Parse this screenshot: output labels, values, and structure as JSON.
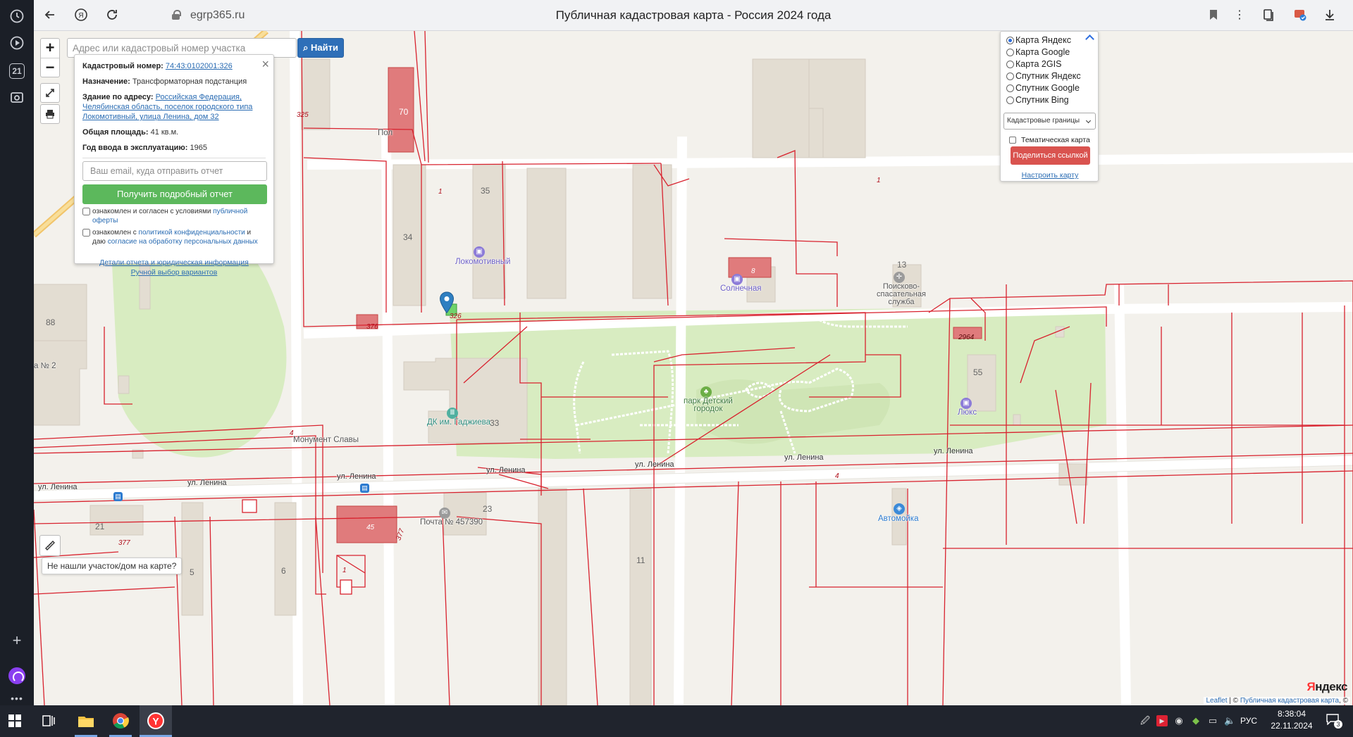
{
  "browser": {
    "address": "egrp365.ru",
    "page_title": "Публичная кадастровая карта - Россия 2024 года",
    "sidebar_badge": "21"
  },
  "search": {
    "placeholder": "Адрес или кадастровый номер участка",
    "value": "",
    "button_label": "Найти"
  },
  "zoom": {
    "in_label": "+",
    "out_label": "−"
  },
  "info_popup": {
    "cad_label": "Кадастровый номер:",
    "cad_value": "74:43:0102001:326",
    "purpose_label": "Назначение:",
    "purpose_value": "Трансформаторная подстанция",
    "building_label": "Здание по адресу:",
    "building_value": "Российская Федерация, Челябинская область, поселок городского типа Локомотивный, улица Ленина, дом 32",
    "area_label": "Общая площадь:",
    "area_value": "41 кв.м.",
    "year_label": "Год ввода в эксплуатацию:",
    "year_value": "1965",
    "email_placeholder": "Ваш email, куда отправить отчет",
    "report_button": "Получить подробный отчет",
    "consent1_text": "ознакомлен и согласен с условиями",
    "consent1_link": "публичной оферты",
    "consent2_text_a": "ознакомлен с",
    "consent2_link_a": "политикой конфиденциальности",
    "consent2_text_b": "и даю",
    "consent2_link_b": "согласие на обработку персональных данных",
    "details_link": "Детали отчета и юридическая информация",
    "manual_link": "Ручной выбор вариантов"
  },
  "layers": {
    "options": [
      {
        "label": "Карта Яндекс",
        "selected": true
      },
      {
        "label": "Карта Google",
        "selected": false
      },
      {
        "label": "Карта 2GIS",
        "selected": false
      },
      {
        "label": "Спутник Яндекс",
        "selected": false
      },
      {
        "label": "Спутник Google",
        "selected": false
      },
      {
        "label": "Спутник Bing",
        "selected": false
      }
    ],
    "select_value": "Кадастровые границы",
    "thematic_label": "Тематическая карта",
    "share_button": "Поделиться ссылкой",
    "customize_link": "Настроить карту"
  },
  "map": {
    "streets": [
      "ул. Ленина",
      "ул. Ленина",
      "ул. Ленина",
      "ул. Ленина",
      "ул. Ленина",
      "ул. Ленина",
      "ул. Ленина"
    ],
    "pois": {
      "lokomotivny": "Локомотивный",
      "solnechnaya": "Солнечная",
      "search_rescue": "Поисково-\nспасательная\nслужба",
      "dk": "ДК им. Гаджиева",
      "park": "парк Детский\nгородок",
      "monument": "Монумент Славы",
      "post": "Почта № 457390",
      "lux": "Люкс",
      "carwash": "Автомойка",
      "pol": "Пол",
      "school": "а № 2"
    },
    "building_numbers": [
      "70",
      "35",
      "34",
      "13",
      "88",
      "55",
      "33",
      "23",
      "21",
      "6",
      "5",
      "11",
      "45",
      "8",
      "2964",
      "1",
      "1",
      "1",
      "4",
      "4"
    ],
    "cad_numbers": [
      "325",
      "326",
      "376",
      "377",
      "377"
    ],
    "tooltip": "Не нашли участок/дом на карте?",
    "attribution_leaflet": "Leaflet",
    "attribution_sep": " | © ",
    "attribution_pkk": "Публичная кадастровая карта",
    "attribution_tail": ", ©",
    "yandex_logo_a": "Я",
    "yandex_logo_b": "ндекс"
  },
  "taskbar": {
    "lang": "РУС",
    "time": "8:38:04",
    "date": "22.11.2024",
    "notif_count": "3"
  },
  "colors": {
    "cadastral_line": "#d8222e",
    "building_fill": "#e3c9c2",
    "highlight_building": "#e07b7c",
    "park": "#d8ecc1",
    "search_button": "#2e6fb8",
    "report_button": "#5cb85c",
    "share_button": "#d9534f"
  }
}
